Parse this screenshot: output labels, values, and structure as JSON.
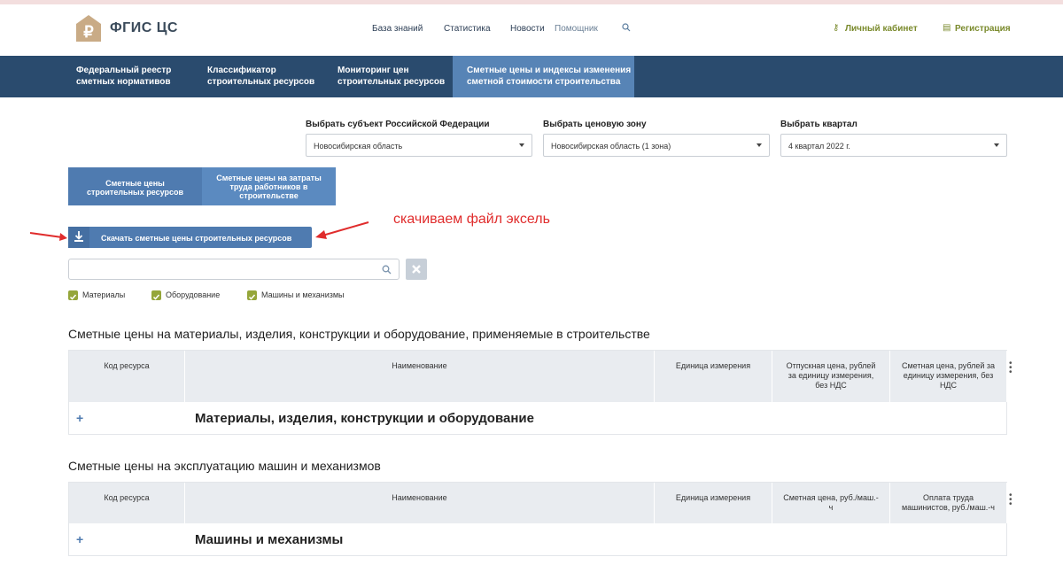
{
  "header": {
    "logo_text": "ФГИС ЦС",
    "nav": [
      "База знаний",
      "Статистика",
      "Новости",
      "Помощник"
    ],
    "account": "Личный кабинет",
    "register": "Регистрация"
  },
  "main_nav": [
    {
      "line1": "Федеральный реестр",
      "line2": "сметных нормативов"
    },
    {
      "line1": "Классификатор",
      "line2": "строительных ресурсов"
    },
    {
      "line1": "Мониторинг цен",
      "line2": "строительных ресурсов"
    },
    {
      "line1": "Сметные цены и индексы изменения",
      "line2": "сметной стоимости строительства"
    }
  ],
  "filters": {
    "region_label": "Выбрать субъект Российской Федерации",
    "region_value": "Новосибирская область",
    "zone_label": "Выбрать ценовую зону",
    "zone_value": "Новосибирская область (1 зона)",
    "quarter_label": "Выбрать квартал",
    "quarter_value": "4 квартал 2022 г."
  },
  "tabs": {
    "tab1_line1": "Сметные цены",
    "tab1_line2": "строительных ресурсов",
    "tab2_line1": "Сметные цены на затраты",
    "tab2_line2": "труда работников в",
    "tab2_line3": "строительстве"
  },
  "download_label": "Скачать сметные цены строительных ресурсов",
  "annotation": "скачиваем файл эксель",
  "checkboxes": [
    "Материалы",
    "Оборудование",
    "Машины и механизмы"
  ],
  "table1": {
    "title": "Сметные цены на материалы, изделия, конструкции и оборудование, применяемые в строительстве",
    "col1": "Код ресурса",
    "col2": "Наименование",
    "col3": "Единица измерения",
    "col4_l1": "Отпускная цена, рублей",
    "col4_l2": "за единицу измерения,",
    "col4_l3": "без НДС",
    "col5_l1": "Сметная цена, рублей за",
    "col5_l2": "единицу измерения, без",
    "col5_l3": "НДС",
    "group": "Материалы, изделия, конструкции и оборудование"
  },
  "table2": {
    "title": "Сметные цены на эксплуатацию машин и механизмов",
    "col1": "Код ресурса",
    "col2": "Наименование",
    "col3": "Единица измерения",
    "col4_l1": "Сметная цена, руб./маш.-",
    "col4_l2": "ч",
    "col5_l1": "Оплата труда",
    "col5_l2": "машинистов, руб./маш.-ч",
    "group": "Машины и механизмы"
  },
  "colors": {
    "nav_bg": "#2a4b6e",
    "nav_active": "#5784b6",
    "button_blue": "#4f7bb0",
    "checkbox_green": "#95a63a",
    "annotation_red": "#e02c2c"
  }
}
